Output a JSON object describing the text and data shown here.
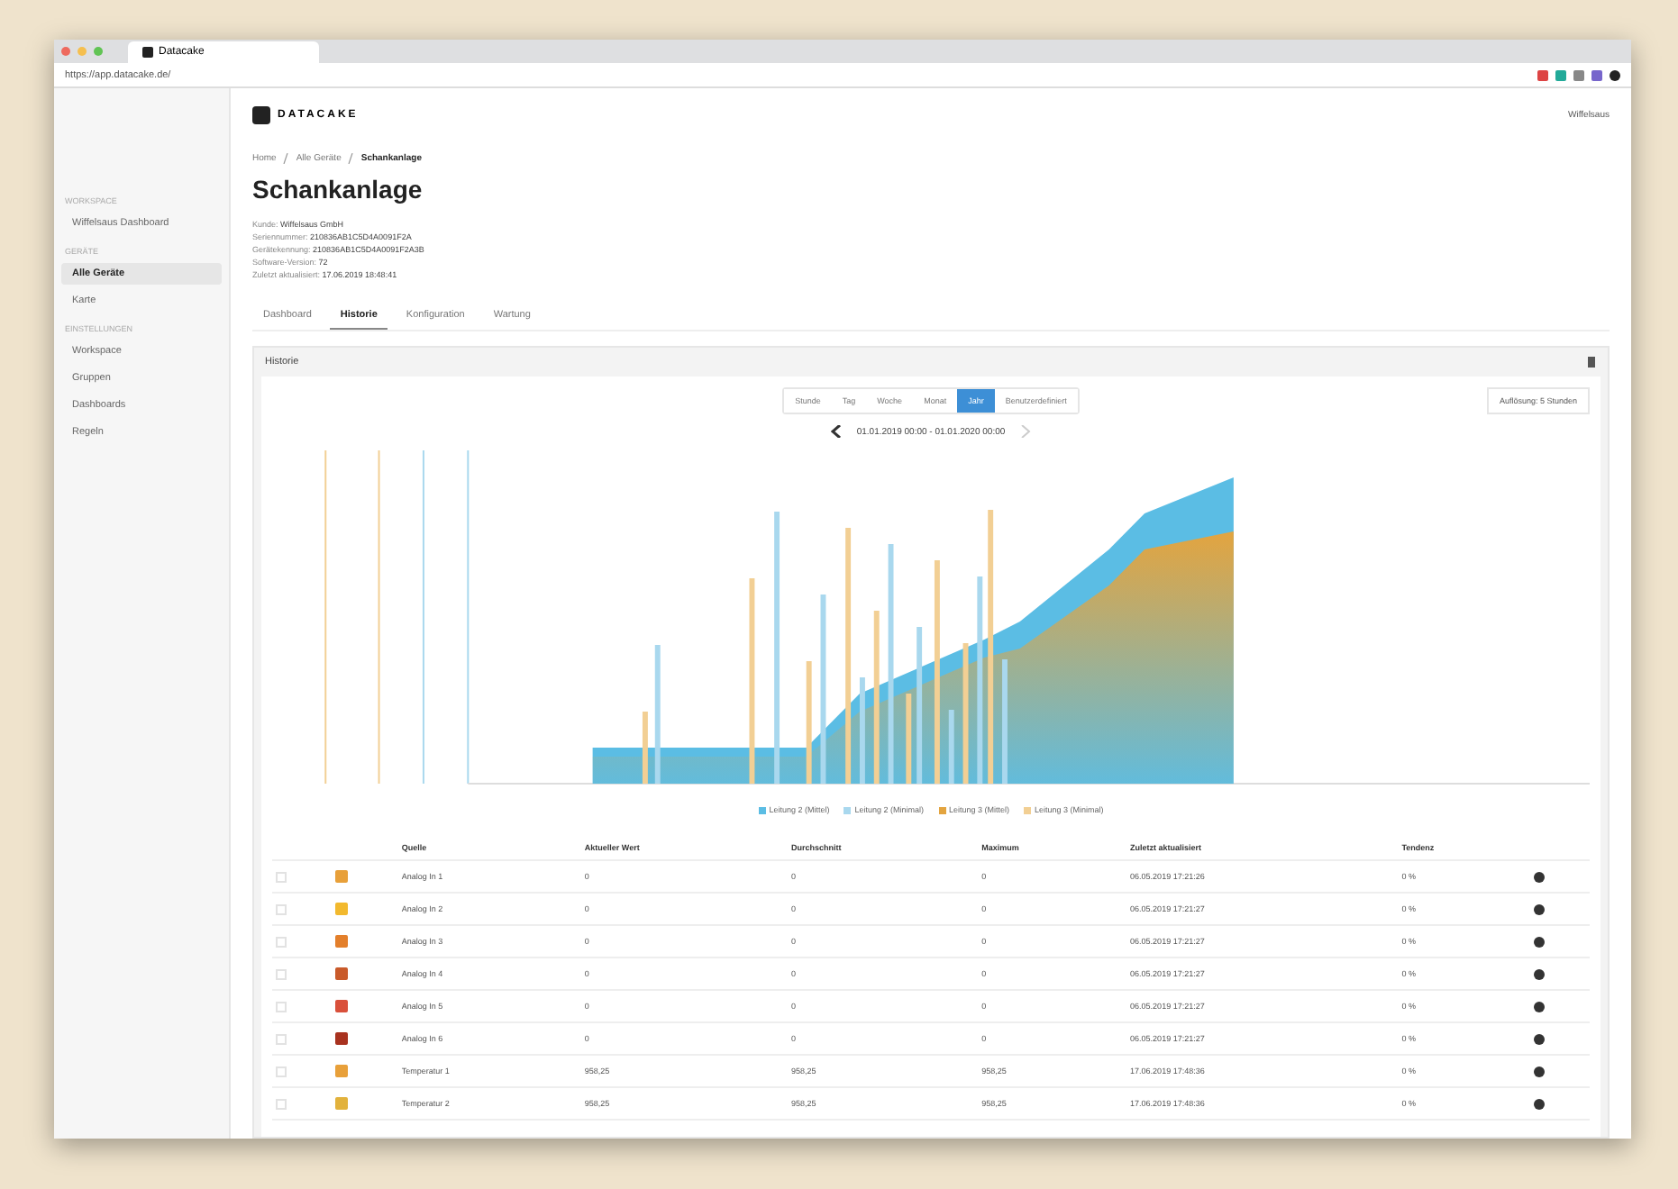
{
  "browser": {
    "tab_title": "Datacake",
    "url": "https://app.datacake.de/"
  },
  "header": {
    "logo": "DATACAKE",
    "user_menu": "Wiffelsaus"
  },
  "sidebar": {
    "sections": [
      {
        "title": "WORKSPACE",
        "items": [
          {
            "label": "Wiffelsaus Dashboard",
            "selected": false
          }
        ]
      },
      {
        "title": "GERÄTE",
        "items": [
          {
            "label": "Alle Geräte",
            "selected": true
          },
          {
            "label": "Karte",
            "selected": false
          }
        ]
      },
      {
        "title": "EINSTELLUNGEN",
        "items": [
          {
            "label": "Workspace",
            "selected": false
          },
          {
            "label": "Gruppen",
            "selected": false
          },
          {
            "label": "Dashboards",
            "selected": false
          },
          {
            "label": "Regeln",
            "selected": false
          }
        ]
      }
    ]
  },
  "breadcrumb": [
    "Home",
    "Alle Geräte",
    "Schankanlage"
  ],
  "page_title": "Schankanlage",
  "meta": [
    {
      "label": "Kunde:",
      "value": "Wiffelsaus GmbH"
    },
    {
      "label": "Seriennummer:",
      "value": "210836AB1C5D4A0091F2A"
    },
    {
      "label": "Gerätekennung:",
      "value": "210836AB1C5D4A0091F2A3B"
    },
    {
      "label": "Software-Version:",
      "value": "72"
    },
    {
      "label": "Zuletzt aktualisiert:",
      "value": "17.06.2019 18:48:41"
    }
  ],
  "tabs": [
    {
      "label": "Dashboard",
      "selected": false
    },
    {
      "label": "Historie",
      "selected": true
    },
    {
      "label": "Konfiguration",
      "selected": false
    },
    {
      "label": "Wartung",
      "selected": false
    }
  ],
  "panel": {
    "title": "Historie",
    "ranges": [
      {
        "label": "Stunde",
        "selected": false
      },
      {
        "label": "Tag",
        "selected": false
      },
      {
        "label": "Woche",
        "selected": false
      },
      {
        "label": "Monat",
        "selected": false
      },
      {
        "label": "Jahr",
        "selected": true
      },
      {
        "label": "Benutzerdefiniert",
        "selected": false
      }
    ],
    "resolution": "Auflösung: 5 Stunden",
    "date_range": "01.01.2019 00:00 - 01.01.2020 00:00",
    "legend": [
      {
        "label": "Leitung 2 (Mittel)",
        "color": "#5bbde4"
      },
      {
        "label": "Leitung 2 (Minimal)",
        "color": "#a9d8ee"
      },
      {
        "label": "Leitung 3 (Mittel)",
        "color": "#e3a43f"
      },
      {
        "label": "Leitung 3 (Minimal)",
        "color": "#f2cf94"
      }
    ]
  },
  "table": {
    "columns": [
      "Quelle",
      "Aktueller Wert",
      "Durchschnitt",
      "Maximum",
      "Zuletzt aktualisiert",
      "Tendenz"
    ],
    "rows": [
      {
        "checked": false,
        "color": "#e8a03a",
        "cells": [
          "Analog In 1",
          "0",
          "0",
          "0",
          "06.05.2019 17:21:26",
          "0 %"
        ]
      },
      {
        "checked": false,
        "color": "#f2b92e",
        "cells": [
          "Analog In 2",
          "0",
          "0",
          "0",
          "06.05.2019 17:21:27",
          "0 %"
        ]
      },
      {
        "checked": false,
        "color": "#e37f2b",
        "cells": [
          "Analog In 3",
          "0",
          "0",
          "0",
          "06.05.2019 17:21:27",
          "0 %"
        ]
      },
      {
        "checked": false,
        "color": "#c95a2a",
        "cells": [
          "Analog In 4",
          "0",
          "0",
          "0",
          "06.05.2019 17:21:27",
          "0 %"
        ]
      },
      {
        "checked": false,
        "color": "#d9503b",
        "cells": [
          "Analog In 5",
          "0",
          "0",
          "0",
          "06.05.2019 17:21:27",
          "0 %"
        ]
      },
      {
        "checked": false,
        "color": "#a8321f",
        "cells": [
          "Analog In 6",
          "0",
          "0",
          "0",
          "06.05.2019 17:21:27",
          "0 %"
        ]
      },
      {
        "checked": false,
        "color": "#e8a03a",
        "cells": [
          "Temperatur 1",
          "958,25",
          "958,25",
          "958,25",
          "17.06.2019 17:48:36",
          "0 %"
        ]
      },
      {
        "checked": false,
        "color": "#e2b23c",
        "cells": [
          "Temperatur 2",
          "958,25",
          "958,25",
          "958,25",
          "17.06.2019 17:48:36",
          "0 %"
        ]
      }
    ]
  }
}
